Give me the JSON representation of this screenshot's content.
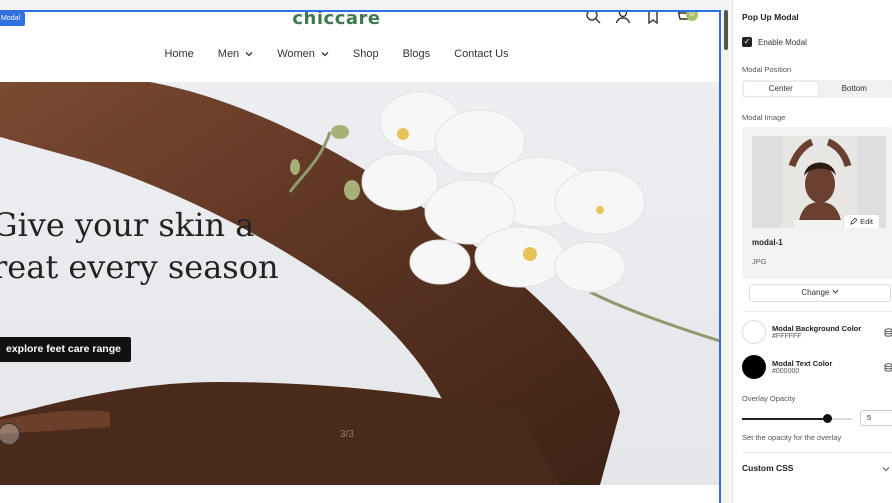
{
  "canvas": {
    "selection_tag": "Modal",
    "site": {
      "logo": "chiccare",
      "cart_count": "0",
      "nav": [
        {
          "label": "Home"
        },
        {
          "label": "Men"
        },
        {
          "label": "Women"
        },
        {
          "label": "Shop"
        },
        {
          "label": "Blogs"
        },
        {
          "label": "Contact Us"
        }
      ],
      "hero": {
        "title_line1": "Give your skin a",
        "title_line2": "reat every season",
        "button_label": "explore feet care range",
        "slide_counter": "3/3"
      }
    }
  },
  "panel": {
    "title": "Pop Up Modal",
    "enable_modal_label": "Enable Modal",
    "enable_modal_checked": true,
    "position_label": "Modal Position",
    "position_options": [
      "Center",
      "Bottom"
    ],
    "position_selected": "Center",
    "image_label": "Modal Image",
    "image": {
      "name": "modal-1",
      "type": "JPG",
      "edit_label": "Edit",
      "change_label": "Change"
    },
    "bg_color": {
      "label": "Modal Background Color",
      "hex": "#FFFFFF"
    },
    "text_color": {
      "label": "Modal Text Color",
      "hex": "#000000"
    },
    "opacity_label": "Overlay Opacity",
    "opacity_value": "5",
    "opacity_fraction": 0.5,
    "opacity_help": "Set the opacity for the overlay",
    "custom_css_label": "Custom CSS"
  },
  "colors": {
    "selection_blue": "#2f6fe0",
    "logo_green": "#3d7a4f",
    "cart_badge": "#a7c26a"
  }
}
